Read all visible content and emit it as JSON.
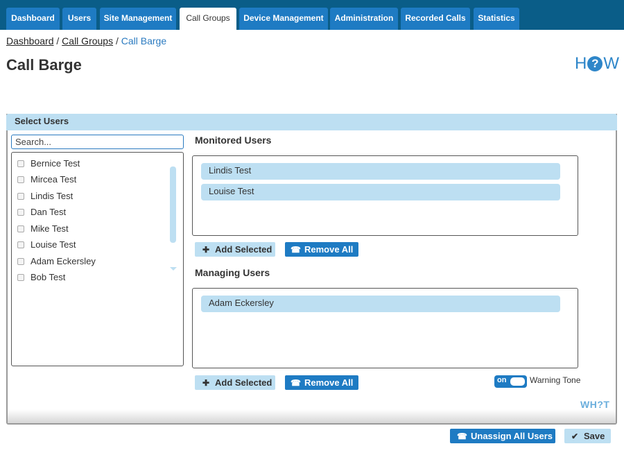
{
  "nav": {
    "tabs": [
      {
        "label": "Dashboard",
        "active": false
      },
      {
        "label": "Users",
        "active": false
      },
      {
        "label": "Site Management",
        "active": false
      },
      {
        "label": "Call Groups",
        "active": true
      },
      {
        "label": "Device Management",
        "active": false
      },
      {
        "label": "Administration",
        "active": false
      },
      {
        "label": "Recorded Calls",
        "active": false
      },
      {
        "label": "Statistics",
        "active": false
      }
    ]
  },
  "breadcrumb": {
    "items": [
      "Dashboard",
      "Call Groups"
    ],
    "separator": "/",
    "current": "Call Barge"
  },
  "page": {
    "title": "Call Barge"
  },
  "help_logo": {
    "text_left": "H",
    "text_icon": "?",
    "text_right": "W"
  },
  "panel": {
    "title": "Select Users"
  },
  "search": {
    "placeholder": "Search...",
    "value": ""
  },
  "user_list": {
    "items": [
      "Bernice Test",
      "Mircea Test",
      "Lindis Test",
      "Dan Test",
      "Mike Test",
      "Louise Test",
      "Adam Eckersley",
      "Bob Test"
    ]
  },
  "monitored": {
    "title": "Monitored Users",
    "users": [
      "Lindis Test",
      "Louise Test"
    ],
    "add_label": "Add Selected",
    "remove_label": "Remove All"
  },
  "managing": {
    "title": "Managing Users",
    "users": [
      "Adam Eckersley"
    ],
    "add_label": "Add Selected",
    "remove_label": "Remove All"
  },
  "warning_tone": {
    "state": "on",
    "label": "Warning Tone"
  },
  "what_logo": {
    "text": "WH?T"
  },
  "footer": {
    "unassign_label": "Unassign All Users",
    "save_label": "Save"
  },
  "colors": {
    "nav_bg": "#0a5d88",
    "tab": "#1e7bc3",
    "light_accent": "#bddff2",
    "link": "#2a7ac0"
  }
}
